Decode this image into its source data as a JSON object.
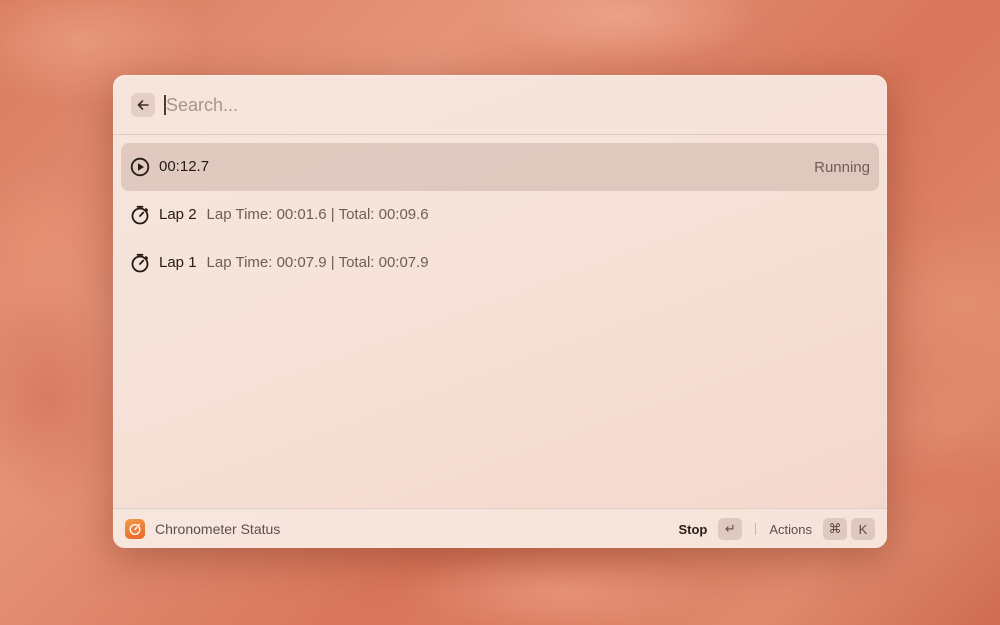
{
  "search": {
    "placeholder": "Search...",
    "back_icon": "arrow-left-icon"
  },
  "items": [
    {
      "title": "00:12.7",
      "subtitle": "",
      "accessory": "Running",
      "icon": "play-circle-icon",
      "selected": true
    },
    {
      "title": "Lap 2",
      "subtitle": "Lap Time: 00:01.6 | Total: 00:09.6",
      "accessory": "",
      "icon": "stopwatch-icon",
      "selected": false
    },
    {
      "title": "Lap 1",
      "subtitle": "Lap Time: 00:07.9 | Total: 00:07.9",
      "accessory": "",
      "icon": "stopwatch-icon",
      "selected": false
    }
  ],
  "footer": {
    "command_title": "Chronometer Status",
    "app_icon": "chronometer-app-icon",
    "primary_action": "Stop",
    "primary_key": "↵",
    "actions_label": "Actions",
    "actions_keys": [
      "⌘",
      "K"
    ]
  },
  "colors": {
    "accent": "#e8642b",
    "selection": "#e0ccc3"
  }
}
